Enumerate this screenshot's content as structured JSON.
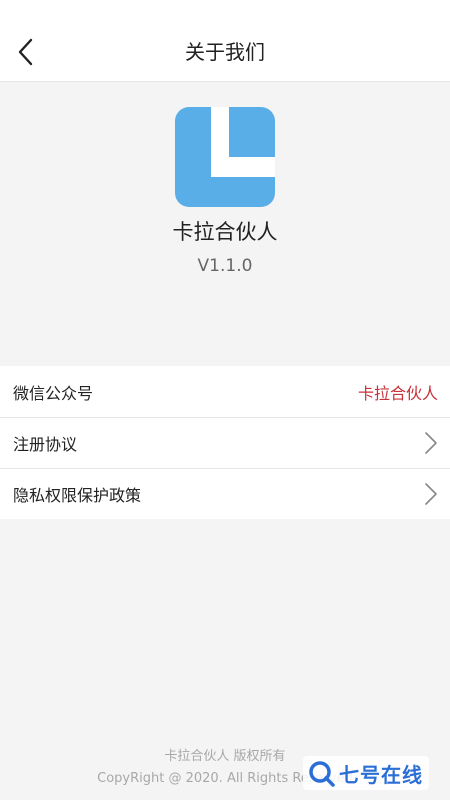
{
  "header": {
    "title": "关于我们",
    "back_icon": "chevron-left-icon"
  },
  "app": {
    "name": "卡拉合伙人",
    "version": "V1.1.0",
    "icon_color": "#5aaee8"
  },
  "menu": {
    "items": [
      {
        "label": "微信公众号",
        "value": "卡拉合伙人",
        "value_color": "#c8323a"
      },
      {
        "label": "注册协议",
        "icon": "chevron-right-icon"
      },
      {
        "label": "隐私权限保护政策",
        "icon": "chevron-right-icon"
      }
    ]
  },
  "footer": {
    "line1": "卡拉合伙人 版权所有",
    "line2": "CopyRight @ 2020. All Rights Reserved"
  },
  "watermark": {
    "text": "七号在线"
  }
}
